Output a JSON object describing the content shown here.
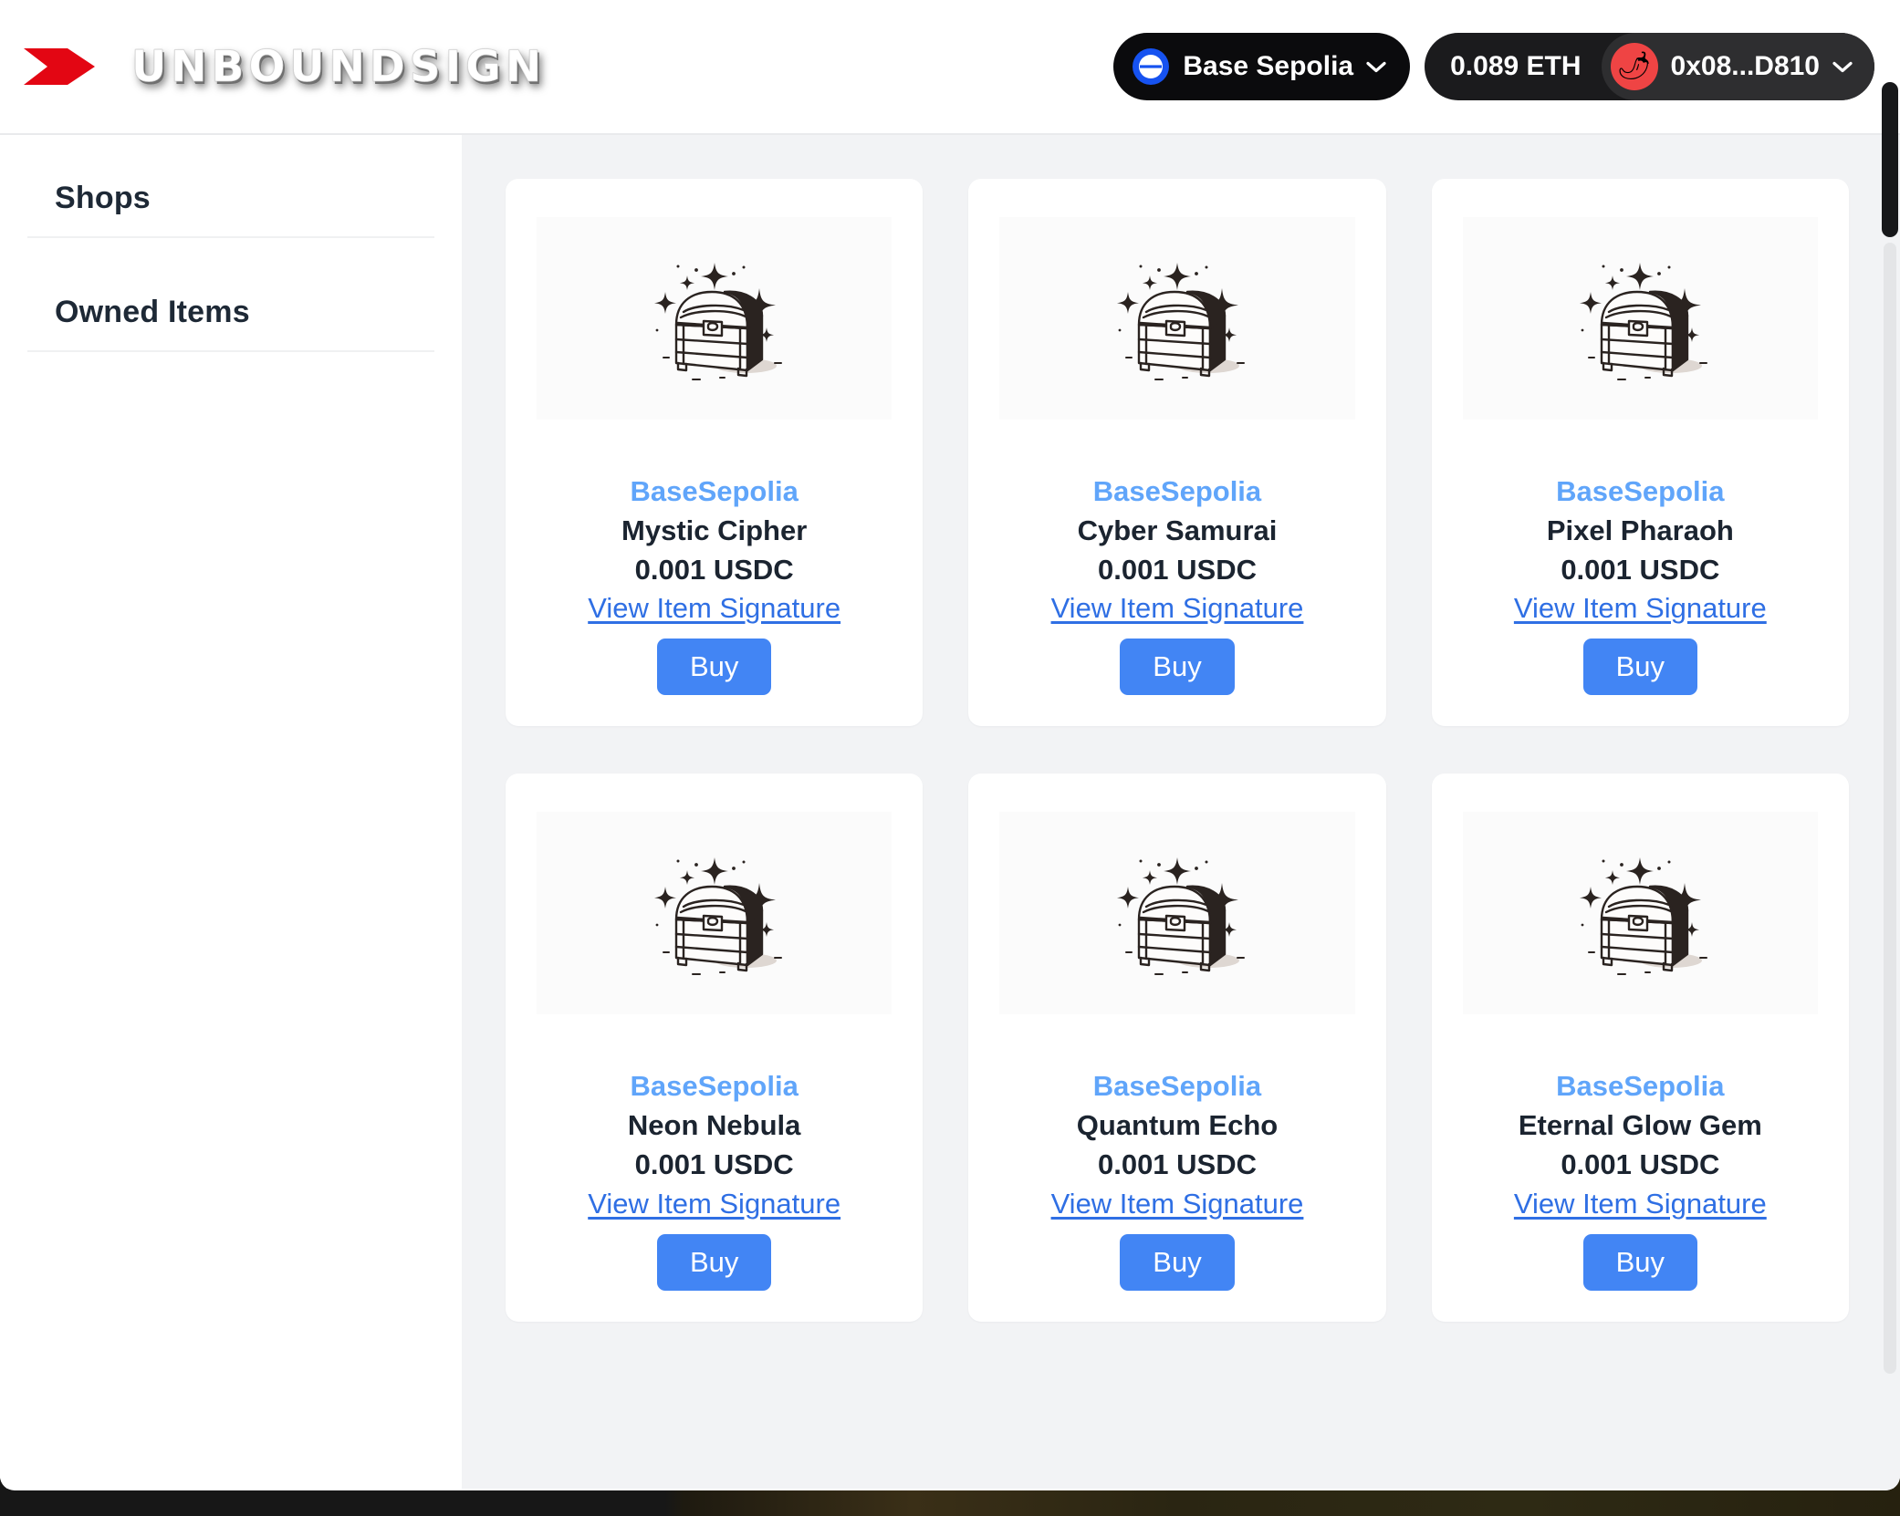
{
  "header": {
    "brand_name": "UNBOUNDSIGN",
    "brand_mark_icon": "red-arrow-chevron-icon",
    "network": {
      "label": "Base Sepolia",
      "icon": "base-network-icon",
      "chevron_icon": "chevron-down-icon",
      "accent_color": "#1652f0"
    },
    "wallet": {
      "balance": "0.089 ETH",
      "address": "0x08...D810",
      "avatar_icon": "chili-pepper-avatar",
      "avatar_glyph": "🌶",
      "avatar_color": "#ef4444",
      "chevron_icon": "chevron-down-icon"
    }
  },
  "sidebar": {
    "items": [
      {
        "label": "Shops"
      },
      {
        "label": "Owned Items"
      }
    ]
  },
  "main": {
    "thumb_icon": "treasure-chest-icon",
    "buy_label": "Buy",
    "signature_link_label": "View Item Signature",
    "accent_blue": "#4285f4",
    "network_text_color": "#60a5fa",
    "items": [
      {
        "network": "BaseSepolia",
        "name": "Mystic Cipher",
        "price": "0.001 USDC",
        "link": "View Item Signature",
        "buy": "Buy"
      },
      {
        "network": "BaseSepolia",
        "name": "Cyber Samurai",
        "price": "0.001 USDC",
        "link": "View Item Signature",
        "buy": "Buy"
      },
      {
        "network": "BaseSepolia",
        "name": "Pixel Pharaoh",
        "price": "0.001 USDC",
        "link": "View Item Signature",
        "buy": "Buy"
      },
      {
        "network": "BaseSepolia",
        "name": "Neon Nebula",
        "price": "0.001 USDC",
        "link": "View Item Signature",
        "buy": "Buy"
      },
      {
        "network": "BaseSepolia",
        "name": "Quantum Echo",
        "price": "0.001 USDC",
        "link": "View Item Signature",
        "buy": "Buy"
      },
      {
        "network": "BaseSepolia",
        "name": "Eternal Glow Gem",
        "price": "0.001 USDC",
        "link": "View Item Signature",
        "buy": "Buy"
      }
    ]
  }
}
